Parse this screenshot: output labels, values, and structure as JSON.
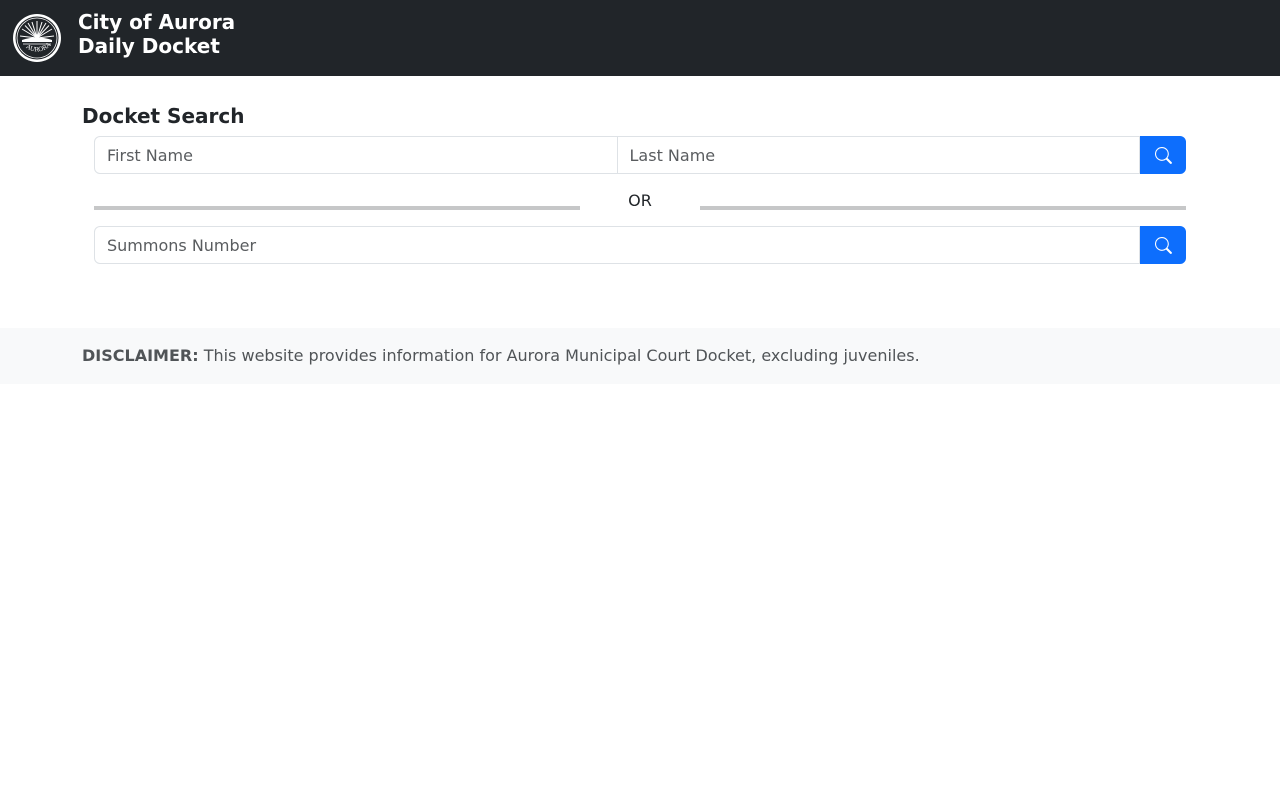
{
  "header": {
    "logo_icon": "aurora-city-seal-icon",
    "title_line1": "City of Aurora",
    "title_line2": "Daily Docket",
    "background_color": "#212529"
  },
  "search": {
    "title": "Docket Search",
    "first_name_placeholder": "First Name",
    "last_name_placeholder": "Last Name",
    "first_name_value": "",
    "last_name_value": "",
    "name_search_icon": "search-icon",
    "or_label": "OR",
    "summons_placeholder": "Summons Number",
    "summons_value": "",
    "summons_search_icon": "search-icon",
    "button_color": "#0d6efd"
  },
  "disclaimer": {
    "label": "DISCLAIMER:",
    "text": " This website provides information for Aurora Municipal Court Docket, excluding juveniles."
  }
}
